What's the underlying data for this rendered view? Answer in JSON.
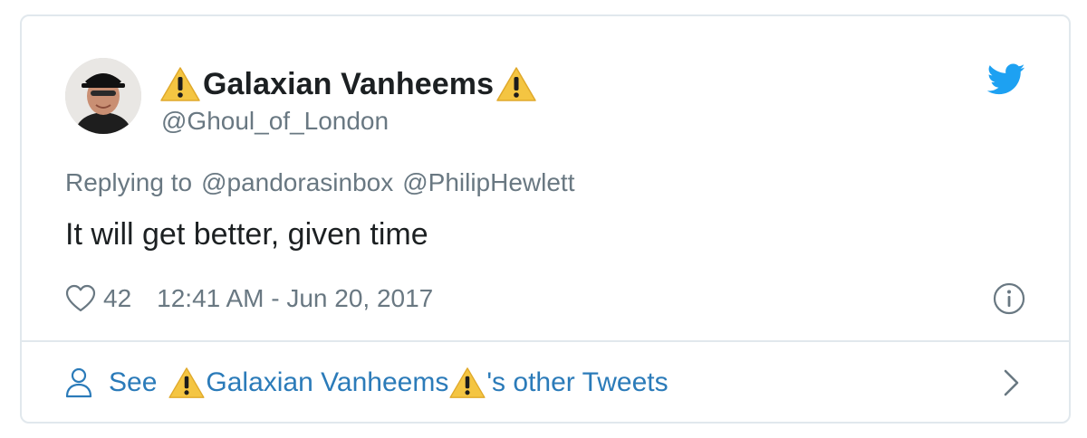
{
  "tweet": {
    "author": {
      "display_name": "Galaxian Vanheems",
      "handle": "@Ghoul_of_London",
      "name_emoji": "warning-sign"
    },
    "replying_to": {
      "prefix": "Replying to",
      "users": [
        "@pandorasinbox",
        "@PhilipHewlett"
      ]
    },
    "text": "It will get better, given time",
    "likes": "42",
    "timestamp": "12:41 AM - Jun 20, 2017",
    "icons": {
      "brand": "twitter-bird-icon",
      "like": "heart-icon",
      "info": "info-icon",
      "profile": "person-icon",
      "more": "chevron-right-icon"
    }
  },
  "footer": {
    "see_label": "See",
    "name": "Galaxian Vanheems",
    "suffix": "'s other Tweets"
  },
  "colors": {
    "primary_text": "#1c2022",
    "secondary_text": "#697882",
    "link": "#2b7bb9",
    "twitter_blue": "#1da1f2",
    "border": "#e1e8ed",
    "warning": "#f4c542"
  }
}
